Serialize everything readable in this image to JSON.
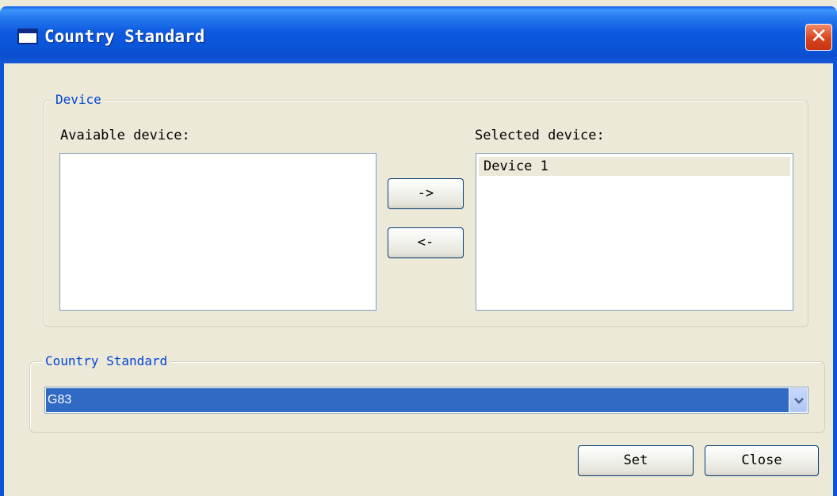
{
  "window": {
    "title": "Country Standard",
    "close_label": "✕"
  },
  "device_group": {
    "legend": "Device",
    "available_label": "Avaiable device:",
    "available_items": [],
    "selected_label": "Selected device:",
    "selected_items": [
      "Device 1"
    ],
    "move_right_label": "->",
    "move_left_label": "<-"
  },
  "country_group": {
    "legend": "Country Standard",
    "selected_value": "G83"
  },
  "footer": {
    "set_label": "Set",
    "close_label": "Close"
  },
  "colors": {
    "titlebar": "#0a54d8",
    "selection": "#316ac5",
    "legend_text": "#0046d5",
    "dialog_bg": "#ece9d8"
  }
}
